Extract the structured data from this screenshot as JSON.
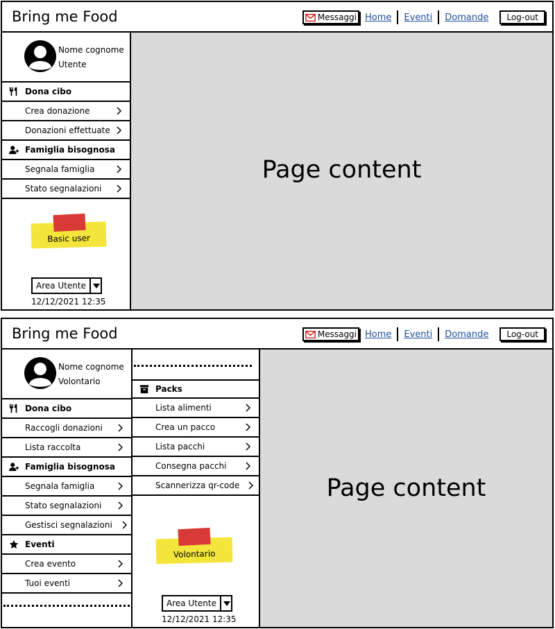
{
  "app_title": "Bring me Food",
  "nav": {
    "messages": "Messaggi",
    "home": "Home",
    "events": "Eventi",
    "questions": "Domande",
    "logout": "Log-out"
  },
  "colors": {
    "link": "#1f4e9c",
    "content_bg": "#dadada",
    "sticky": "#f3e53b",
    "tape": "#d83a35",
    "envelope": "#d11c1c"
  },
  "screen1": {
    "user": {
      "name": "Nome cognome",
      "role": "Utente"
    },
    "sections": [
      {
        "label": "Dona cibo",
        "icon": "fork-knife-icon",
        "items": [
          "Crea donazione",
          "Donazioni effettuate"
        ]
      },
      {
        "label": "Famiglia bisognosa",
        "icon": "add-user-icon",
        "items": [
          "Segnala famiglia",
          "Stato segnalazioni"
        ]
      }
    ],
    "badge": "Basic user",
    "area_select": "Area Utente",
    "timestamp": "12/12/2021 12:35",
    "content": "Page content"
  },
  "screen2": {
    "user": {
      "name": "Nome cognome",
      "role": "Volontario"
    },
    "sections": [
      {
        "label": "Dona cibo",
        "icon": "fork-knife-icon",
        "items": [
          "Raccogli donazioni",
          "Lista raccolta"
        ]
      },
      {
        "label": "Famiglia bisognosa",
        "icon": "add-user-icon",
        "items": [
          "Segnala famiglia",
          "Stato segnalazioni",
          "Gestisci segnalazioni"
        ]
      },
      {
        "label": "Eventi",
        "icon": "star-icon",
        "items": [
          "Crea evento",
          "Tuoi eventi"
        ]
      }
    ],
    "packs": {
      "label": "Packs",
      "icon": "archive-box-icon",
      "items": [
        "Lista alimenti",
        "Crea un pacco",
        "Lista pacchi",
        "Consegna pacchi",
        "Scannerizza qr-code"
      ]
    },
    "badge": "Volontario",
    "area_select": "Area Utente",
    "timestamp": "12/12/2021 12:35",
    "content": "Page content"
  }
}
